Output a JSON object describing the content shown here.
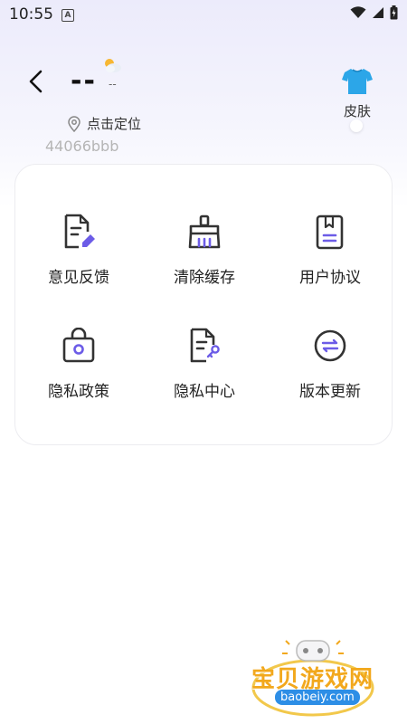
{
  "status_bar": {
    "time": "10:55",
    "a_badge": "A"
  },
  "header": {
    "title": "--",
    "weather": "--",
    "skin_label": "皮肤"
  },
  "location": {
    "label": "点击定位"
  },
  "device_id": "44066bbb",
  "menu": [
    {
      "label": "意见反馈"
    },
    {
      "label": "清除缓存"
    },
    {
      "label": "用户协议"
    },
    {
      "label": "隐私政策"
    },
    {
      "label": "隐私中心"
    },
    {
      "label": "版本更新"
    }
  ],
  "watermark": {
    "title": "宝贝游戏网",
    "site": "baobeiy.com"
  },
  "colors": {
    "accent": "#6C5CE7",
    "icon_stroke": "#333333",
    "skin_shirt": "#2CA6E8"
  }
}
